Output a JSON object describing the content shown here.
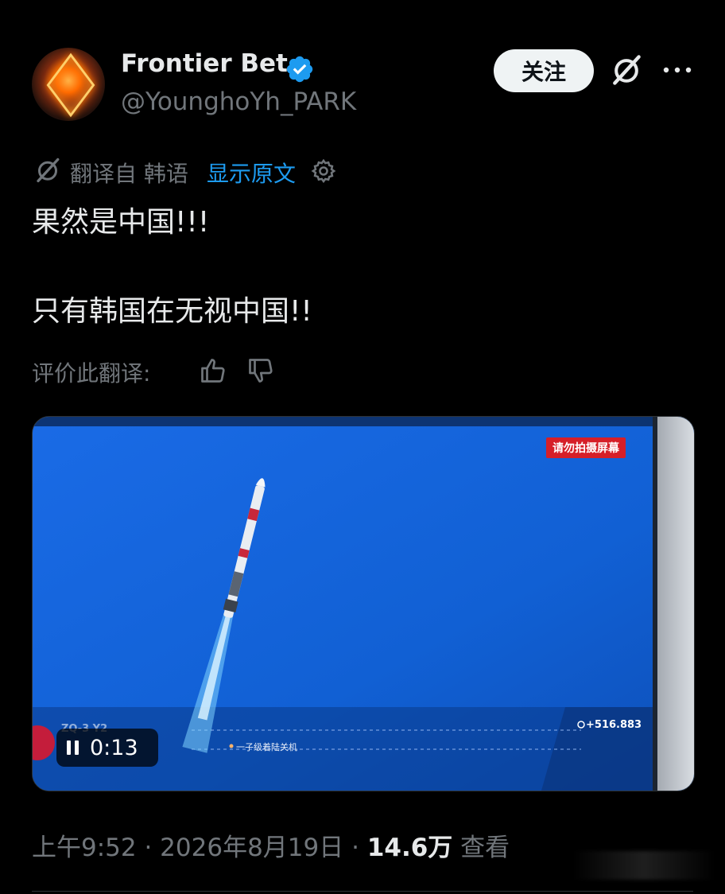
{
  "author": {
    "display_name": "Frontier Bet",
    "handle": "@YounghoYh_PARK"
  },
  "header": {
    "follow_label": "关注"
  },
  "translation": {
    "label": "翻译自 韩语",
    "show_original": "显示原文"
  },
  "post": {
    "line1": "果然是中国!!!",
    "line2": "只有韩国在无视中国!!"
  },
  "rating": {
    "label": "评价此翻译:"
  },
  "video": {
    "badge": "请勿拍摄屏幕",
    "telemetry": "+516.883",
    "event": "一子级着陆关机",
    "mission": "ZQ-3 Y2",
    "time": "0:13"
  },
  "footer": {
    "time_date": "上午9:52 · 2026年8月19日 · ",
    "views": "14.6万",
    "views_suffix": " 查看"
  },
  "colors": {
    "background": "#000000",
    "text": "#e7e9ea",
    "secondary": "#71767b",
    "link": "#1d9bf0",
    "verified": "#1d9bf0",
    "video_sky": "#1664d8"
  }
}
